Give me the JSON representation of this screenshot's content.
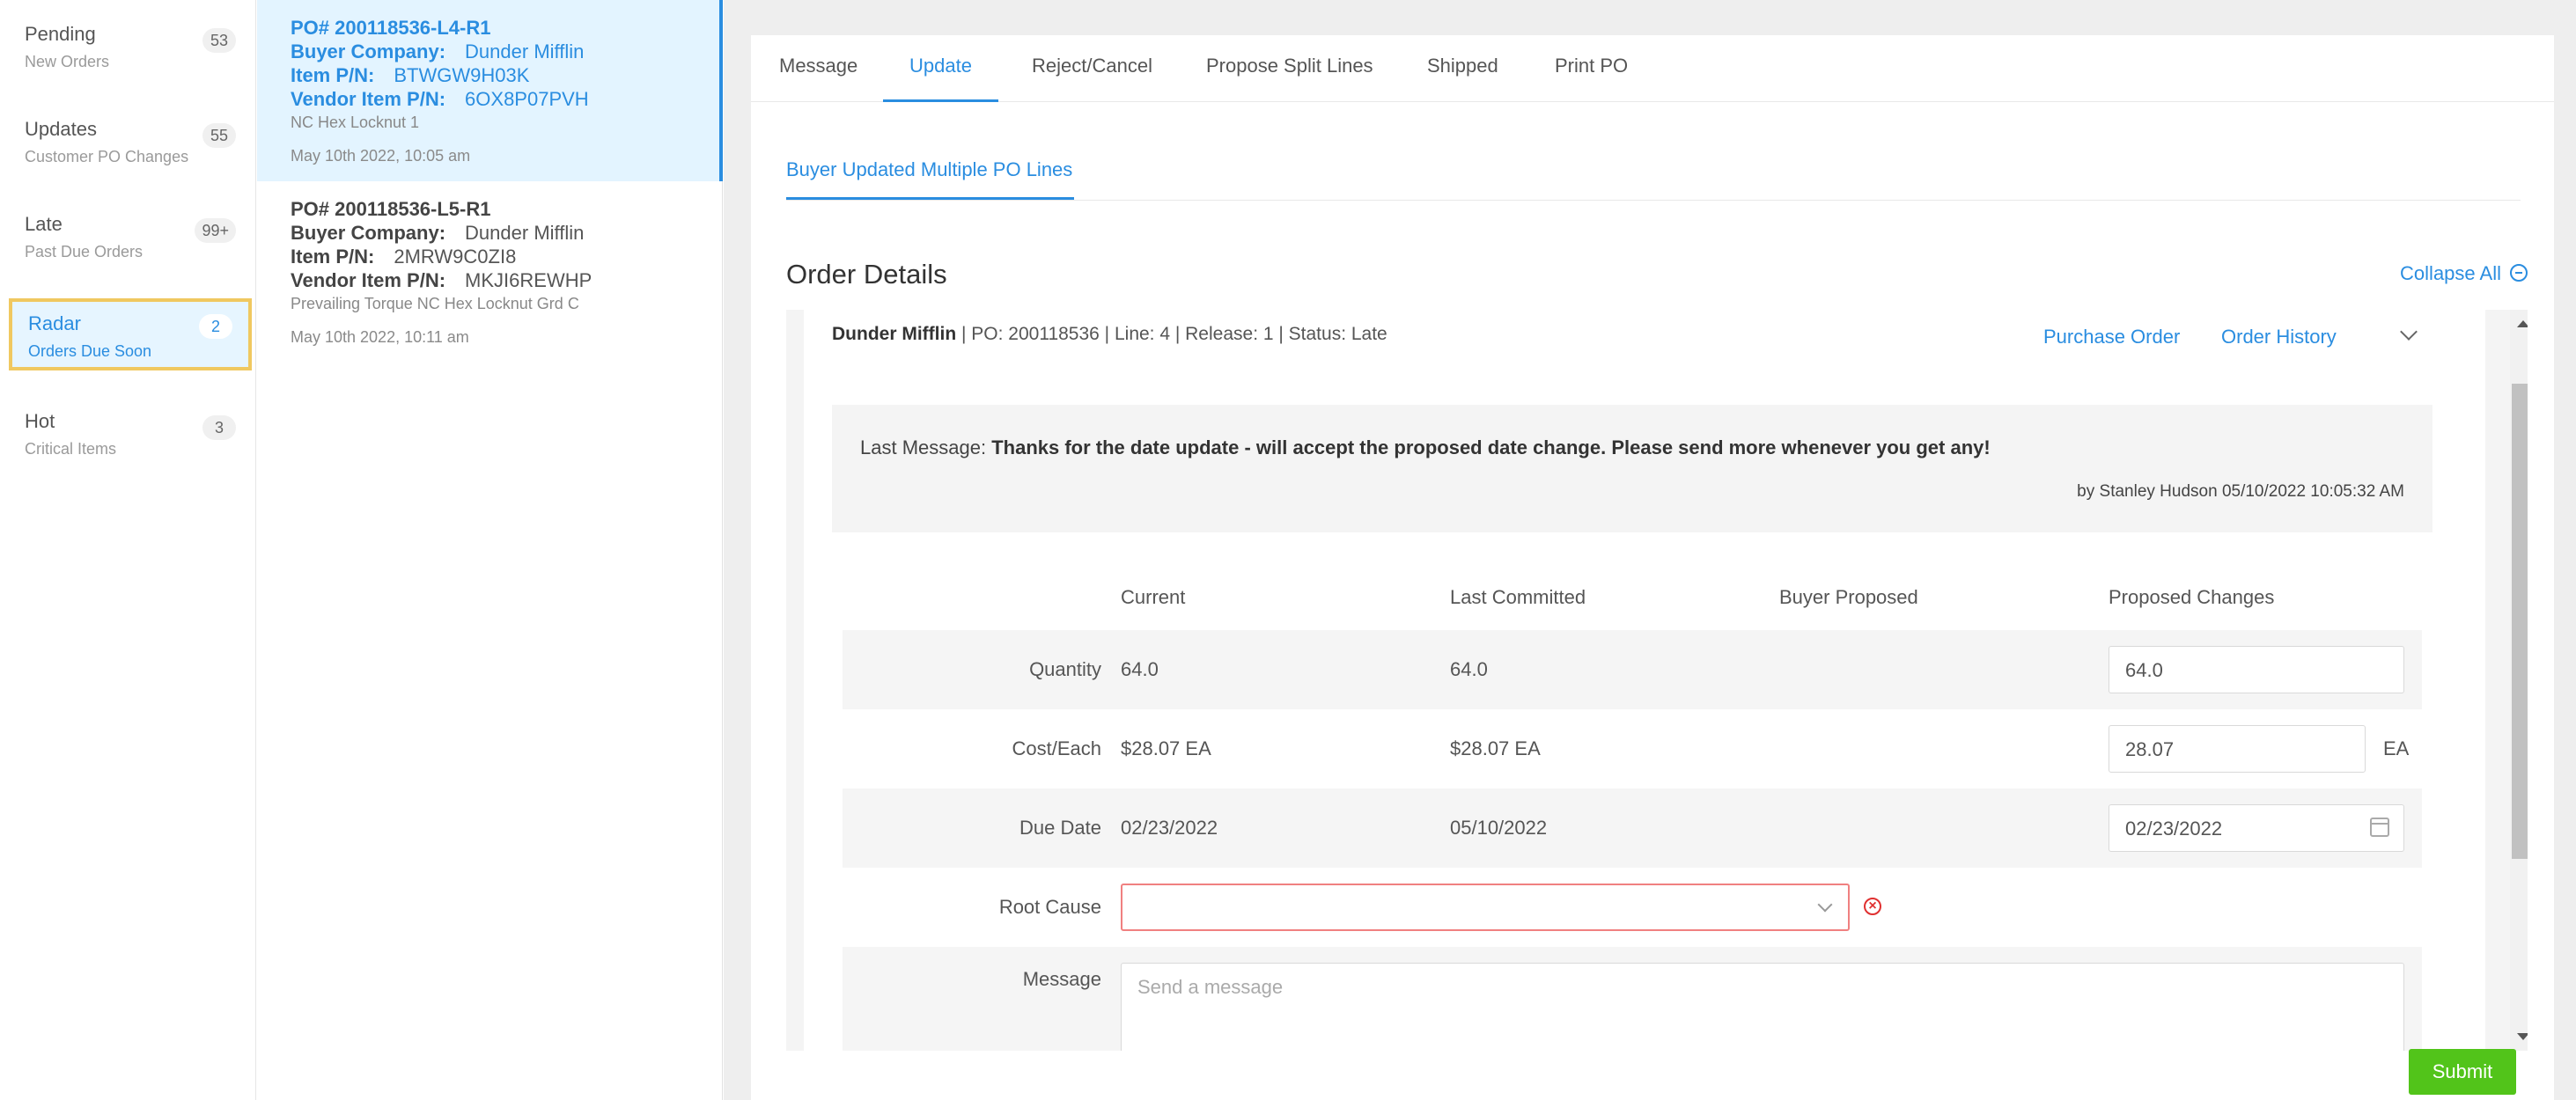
{
  "sidebar": {
    "items": [
      {
        "title": "Pending",
        "sub": "New Orders",
        "badge": "53"
      },
      {
        "title": "Updates",
        "sub": "Customer PO Changes",
        "badge": "55"
      },
      {
        "title": "Late",
        "sub": "Past Due Orders",
        "badge": "99+"
      },
      {
        "title": "Radar",
        "sub": "Orders Due Soon",
        "badge": "2"
      },
      {
        "title": "Hot",
        "sub": "Critical Items",
        "badge": "3"
      }
    ]
  },
  "orders": [
    {
      "po": "PO# 200118536-L4-R1",
      "buyer_label": "Buyer Company:",
      "buyer": "Dunder Mifflin",
      "item_label": "Item P/N:",
      "item": "BTWGW9H03K",
      "vendor_label": "Vendor Item P/N:",
      "vendor": "6OX8P07PVH",
      "desc": "NC Hex Locknut 1",
      "date": "May 10th 2022, 10:05 am"
    },
    {
      "po": "PO# 200118536-L5-R1",
      "buyer_label": "Buyer Company:",
      "buyer": "Dunder Mifflin",
      "item_label": "Item P/N:",
      "item": "2MRW9C0ZI8",
      "vendor_label": "Vendor Item P/N:",
      "vendor": "MKJI6REWHP",
      "desc": "Prevailing Torque NC Hex Locknut Grd C",
      "date": "May 10th 2022, 10:11 am"
    }
  ],
  "tabs": [
    "Message",
    "Update",
    "Reject/Cancel",
    "Propose Split Lines",
    "Shipped",
    "Print PO"
  ],
  "subtab": "Buyer Updated Multiple PO Lines",
  "order_details": {
    "heading": "Order Details",
    "collapse_all": "Collapse All",
    "header_company": "Dunder Mifflin",
    "header_rest": " | PO: 200118536 | Line: 4 | Release: 1 | Status: Late",
    "purchase_order_link": "Purchase Order",
    "order_history_link": "Order History",
    "last_message_label": "Last Message:",
    "last_message": "Thanks for the date update - will accept the proposed date change. Please send more whenever you get any!",
    "last_message_by": "by Stanley Hudson 05/10/2022 10:05:32 AM",
    "columns": [
      "Current",
      "Last Committed",
      "Buyer Proposed",
      "Proposed Changes"
    ],
    "rows": {
      "quantity": {
        "label": "Quantity",
        "current": "64.0",
        "last": "64.0",
        "proposed": "64.0"
      },
      "cost": {
        "label": "Cost/Each",
        "current": "$28.07 EA",
        "last": "$28.07 EA",
        "proposed": "28.07",
        "unit": "EA"
      },
      "due": {
        "label": "Due Date",
        "current": "02/23/2022",
        "last": "05/10/2022",
        "proposed": "02/23/2022"
      }
    },
    "root_cause_label": "Root Cause",
    "message_label": "Message",
    "message_placeholder": "Send a message"
  },
  "submit_label": "Submit",
  "colors": {
    "accent": "#2a8de0",
    "submit": "#52c41a",
    "error": "#e03030",
    "highlight": "#f0c860"
  }
}
